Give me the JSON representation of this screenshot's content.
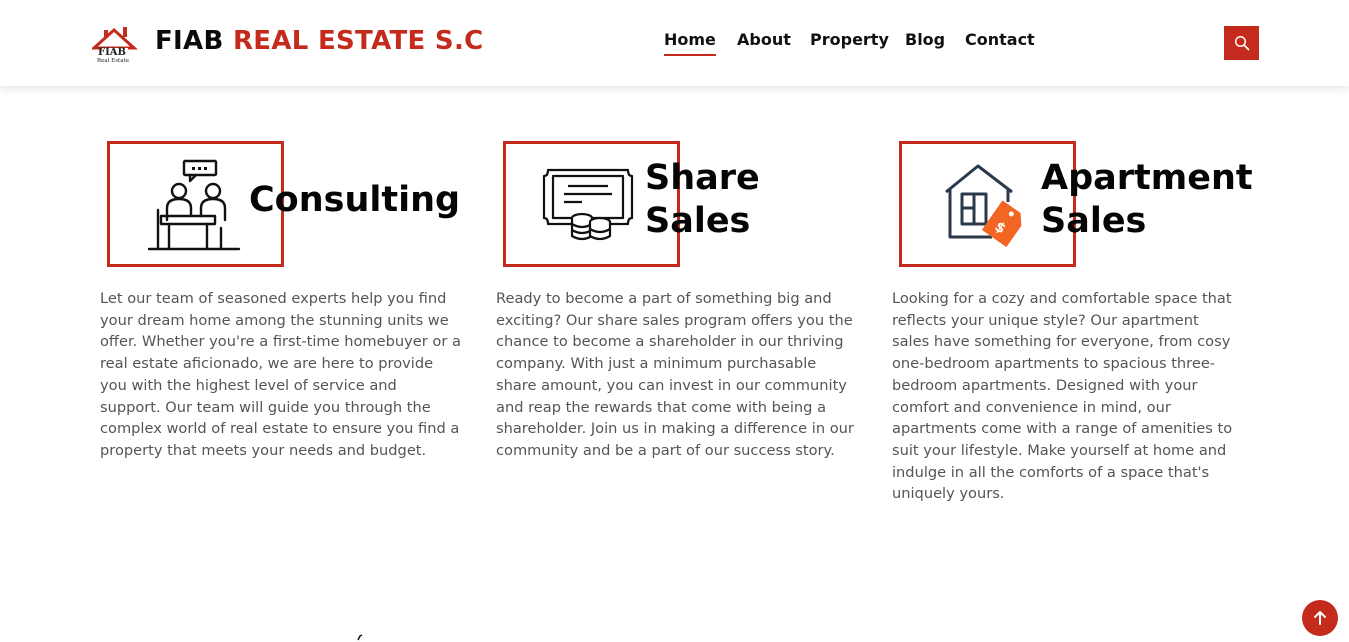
{
  "header": {
    "logo_text": "FIAB",
    "logo_subtext": "Real Estate",
    "brand_part1": "FIAB",
    "brand_part2": "REAL ESTATE S.C",
    "nav": [
      "Home",
      "About",
      "Property",
      "Blog",
      "Contact"
    ],
    "active_nav": "Home"
  },
  "colors": {
    "accent": "#c42b1c",
    "text": "#555555",
    "heading": "#050505",
    "tag": "#f26522",
    "icon_stroke": "#2b3a4a"
  },
  "icons": {
    "search": "search-icon",
    "scroll_top": "arrow-up-icon"
  },
  "services": [
    {
      "title_line1": "Consulting",
      "title_line2": "",
      "icon": "consulting-icon",
      "text": "Let our team of seasoned experts help you find your dream home among the stunning units we offer. Whether you're a first-time homebuyer or a real estate aficionado, we are here to provide you with the highest level of service and support. Our team will guide you through the complex world of real estate to ensure you find a property that meets your needs and budget."
    },
    {
      "title_line1": "Share",
      "title_line2": "Sales",
      "icon": "share-certificate-icon",
      "text": "Ready to become a part of something big and exciting? Our share sales program offers you the chance to become a shareholder in our thriving company. With just a minimum purchasable share amount, you can invest in our community and reap the rewards that come with being a shareholder. Join us in making a difference in our community and be a part of our success story."
    },
    {
      "title_line1": "Apartment",
      "title_line2": "Sales",
      "icon": "house-price-tag-icon",
      "text": "Looking for a cozy and comfortable space that reflects your unique style? Our apartment sales have something for everyone, from cosy one-bedroom apartments to spacious three-bedroom apartments. Designed with your comfort and convenience in mind, our apartments come with a range of amenities to suit your lifestyle. Make yourself at home and indulge in all the comforts of a space that's uniquely yours."
    }
  ]
}
